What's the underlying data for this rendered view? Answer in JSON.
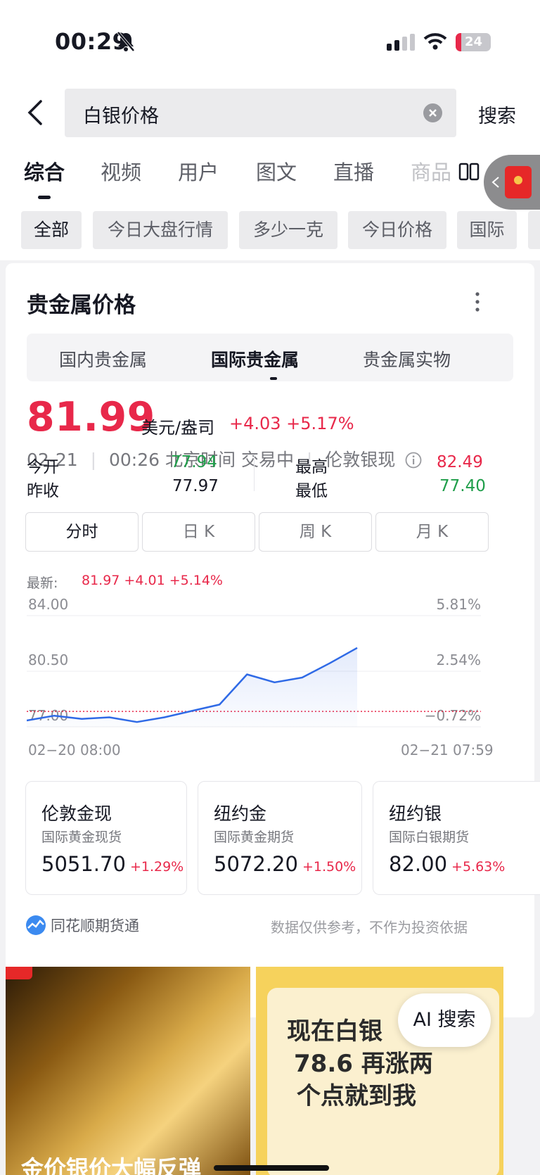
{
  "status": {
    "time": "00:29",
    "battery": "24"
  },
  "search": {
    "query": "白银价格",
    "button": "搜索"
  },
  "tabs": [
    "综合",
    "视频",
    "用户",
    "图文",
    "直播",
    "商品"
  ],
  "chips": [
    "全部",
    "今日大盘行情",
    "多少一克",
    "今日价格",
    "国际"
  ],
  "card": {
    "title": "贵金属价格",
    "segments": [
      "国内贵金属",
      "国际贵金属",
      "贵金属实物"
    ],
    "price": "81.99",
    "unit": "美元/盎司",
    "change": "+4.03 +5.17%",
    "date": "02-21",
    "time_status": "00:26 北京时间 交易中",
    "instrument": "伦敦银现",
    "stats": {
      "open_label": "今开",
      "open": "77.94",
      "prev_label": "昨收",
      "prev": "77.97",
      "high_label": "最高",
      "high": "82.49",
      "low_label": "最低",
      "low": "77.40"
    },
    "kline_tabs": [
      "分时",
      "日 K",
      "周 K",
      "月 K"
    ],
    "latest_label": "最新:",
    "latest_value": "81.97 +4.01 +5.14%",
    "y_left": [
      "84.00",
      "80.50",
      "77.00"
    ],
    "y_right": [
      "5.81%",
      "2.54%",
      "−0.72%"
    ],
    "x_labels": [
      "02−20 08:00",
      "02−21 07:59"
    ],
    "minis": [
      {
        "title": "伦敦金现",
        "sub": "国际黄金现货",
        "value": "5051.70",
        "pct": "+1.29%"
      },
      {
        "title": "纽约金",
        "sub": "国际黄金期货",
        "value": "5072.20",
        "pct": "+1.50%"
      },
      {
        "title": "纽约银",
        "sub": "国际白银期货",
        "value": "82.00",
        "pct": "+5.63%"
      }
    ],
    "source": "同花顺期货通",
    "disclaimer": "数据仅供参考，不作为投资依据"
  },
  "thumbs": {
    "left_caption": "金价银价大幅反弹",
    "right_line1": "现在白银",
    "right_line2": "78.6 再涨两",
    "right_line3": "个点就到我"
  },
  "ai_button": "AI 搜索",
  "chart_data": {
    "type": "line",
    "title": "",
    "ylim": [
      77.0,
      84.0
    ],
    "reference_price": 77.97,
    "x": [
      "02-20 08:00",
      "02-20 10:00",
      "02-20 12:00",
      "02-20 14:00",
      "02-20 16:00",
      "02-20 18:00",
      "02-20 20:00",
      "02-20 21:00",
      "02-20 22:00",
      "02-20 23:00",
      "02-21 00:00",
      "02-21 00:20",
      "02-21 00:26"
    ],
    "series": [
      {
        "values": [
          77.4,
          77.7,
          77.5,
          77.6,
          77.3,
          77.6,
          78.0,
          78.4,
          80.3,
          79.8,
          80.1,
          81.0,
          81.97
        ]
      }
    ]
  }
}
